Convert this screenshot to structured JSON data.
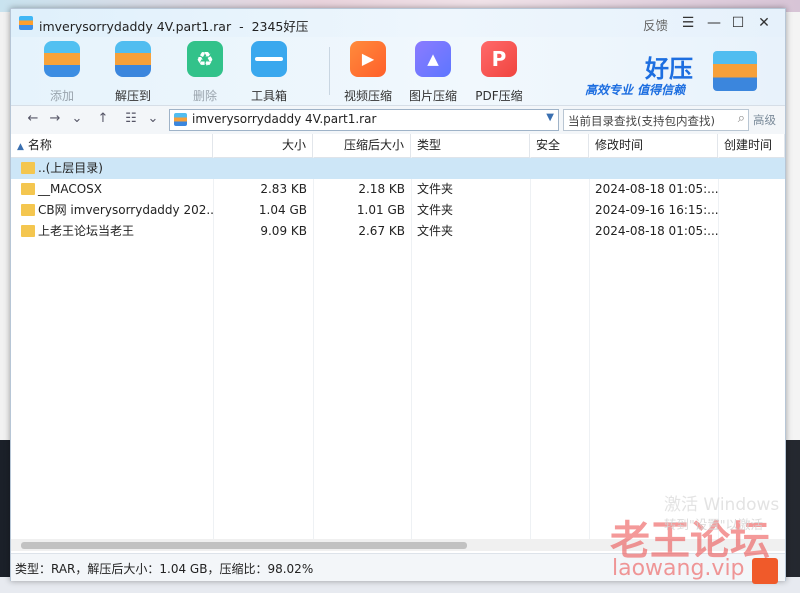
{
  "window": {
    "title_file": "imverysorrydaddy  4V.part1.rar",
    "title_sep": "-",
    "title_app": "2345好压",
    "feedback_label": "反馈"
  },
  "toolbar": {
    "items": [
      {
        "label": "添加",
        "icon": "add-archive-icon",
        "enabled": false
      },
      {
        "label": "解压到",
        "icon": "extract-icon",
        "enabled": true
      },
      {
        "label": "删除",
        "icon": "recycle-icon",
        "enabled": false
      },
      {
        "label": "工具箱",
        "icon": "toolbox-icon",
        "enabled": true
      },
      {
        "label": "视频压缩",
        "icon": "video-compress-icon",
        "enabled": true
      },
      {
        "label": "图片压缩",
        "icon": "image-compress-icon",
        "enabled": true
      },
      {
        "label": "PDF压缩",
        "icon": "pdf-compress-icon",
        "enabled": true
      }
    ],
    "brand": {
      "name": "好压",
      "slogan": "高效专业  值得信赖"
    }
  },
  "address": {
    "path": "imverysorrydaddy  4V.part1.rar",
    "search_placeholder": "当前目录查找(支持包内查找)",
    "advanced_label": "高级"
  },
  "columns": {
    "name": "名称",
    "size": "大小",
    "packed": "压缩后大小",
    "type": "类型",
    "security": "安全",
    "modified": "修改时间",
    "created": "创建时间"
  },
  "rows": [
    {
      "name": "..(上层目录)",
      "size": "",
      "packed": "",
      "type": "",
      "security": "",
      "modified": "",
      "created": ""
    },
    {
      "name": "__MACOSX",
      "size": "2.83 KB",
      "packed": "2.18 KB",
      "type": "文件夹",
      "security": "",
      "modified": "2024-08-18 01:05:...",
      "created": ""
    },
    {
      "name": "CB网 imverysorrydaddy 202...",
      "size": "1.04 GB",
      "packed": "1.01 GB",
      "type": "文件夹",
      "security": "",
      "modified": "2024-09-16 16:15:...",
      "created": ""
    },
    {
      "name": "上老王论坛当老王",
      "size": "9.09 KB",
      "packed": "2.67 KB",
      "type": "文件夹",
      "security": "",
      "modified": "2024-08-18 01:05:...",
      "created": ""
    }
  ],
  "status": {
    "text": "类型：RAR，解压后大小：1.04 GB，压缩比：98.02%"
  },
  "overlay": {
    "activate_line1": "激活 Windows",
    "activate_line2": "转到\"设置\"以激活",
    "forum_watermark": "老王论坛",
    "url_watermark": "laowang.vip"
  }
}
